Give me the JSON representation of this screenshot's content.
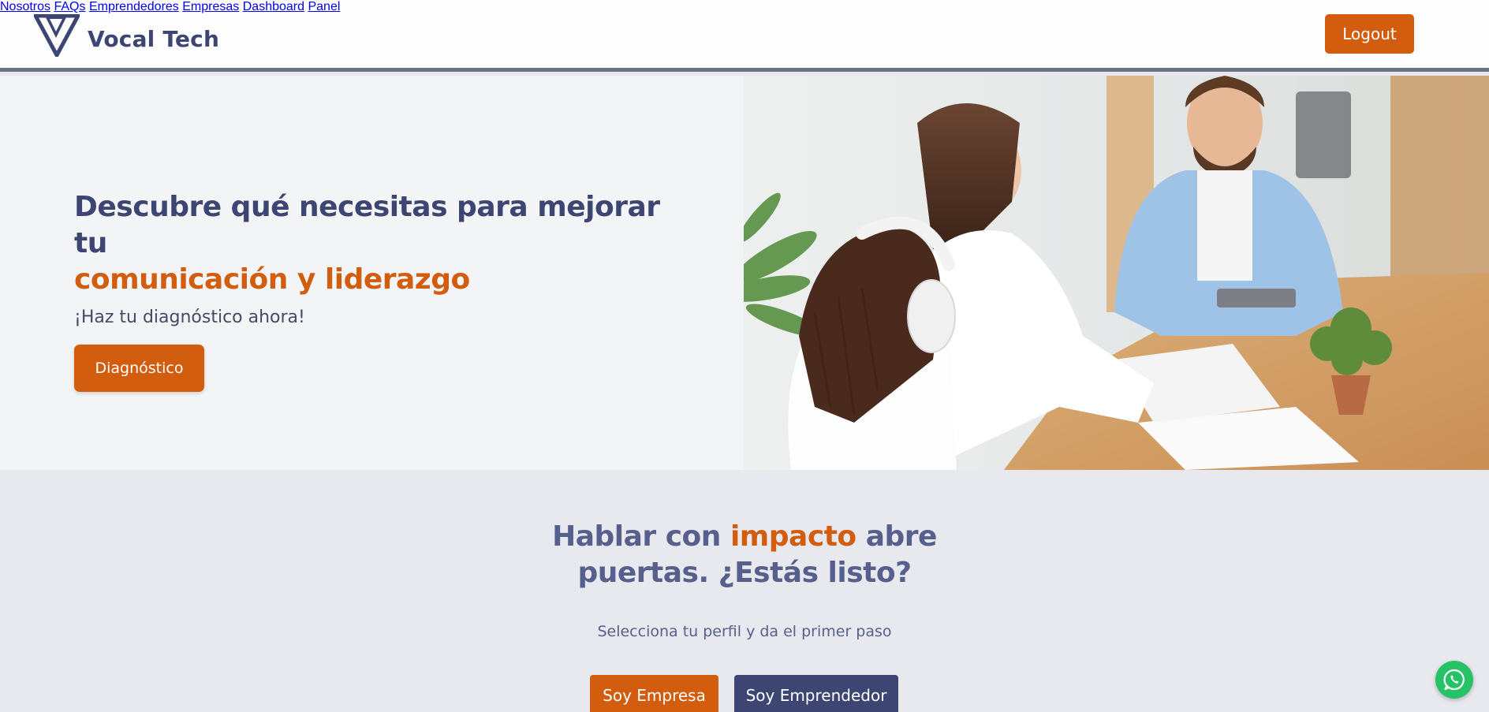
{
  "brand": {
    "name": "Vocal Tech"
  },
  "nav": {
    "items": [
      {
        "label": "Nosotros"
      },
      {
        "label": "FAQs"
      },
      {
        "label": "Emprendedores"
      },
      {
        "label": "Empresas"
      },
      {
        "label": "Dashboard"
      },
      {
        "label": "Panel"
      }
    ],
    "logout_label": "Logout"
  },
  "hero": {
    "title_part1": "Descubre qué necesitas para mejorar tu",
    "title_accent": "comunicación y liderazgo",
    "subtitle": "¡Haz tu diagnóstico ahora!",
    "cta_label": "Diagnóstico",
    "image_alt": "Reunión de trabajo con tres personas en una mesa de madera"
  },
  "cta": {
    "title_part1": "Hablar con",
    "title_accent": "impacto",
    "title_part2": "abre",
    "title_line2": "puertas. ¿Estás listo?",
    "subtitle": "Selecciona tu perfil y da el primer paso",
    "btn_empresa": "Soy Empresa",
    "btn_emprendedor": "Soy Emprendedor"
  },
  "colors": {
    "primary": "#3d4573",
    "accent": "#d35d0e",
    "whatsapp": "#25c366"
  },
  "icons": {
    "whatsapp": "whatsapp-icon",
    "logo": "triangle-logo-icon"
  }
}
